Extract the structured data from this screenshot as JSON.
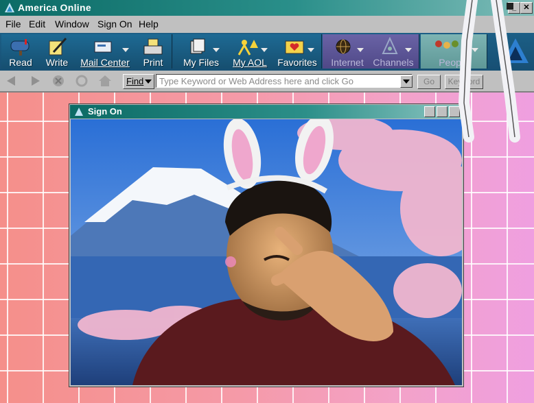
{
  "window": {
    "title": "America  Online",
    "minimize_glyph": "_",
    "close_glyph": "✕"
  },
  "menu": {
    "items": [
      "File",
      "Edit",
      "Window",
      "Sign On",
      "Help"
    ]
  },
  "toolbar": {
    "buttons": [
      {
        "label": "Read",
        "icon": "mailbox-icon"
      },
      {
        "label": "Write",
        "icon": "pencil-paper-icon"
      },
      {
        "label": "Mail Center",
        "icon": "mail-center-icon"
      },
      {
        "label": "Print",
        "icon": "printer-icon"
      },
      {
        "label": "My Files",
        "icon": "files-icon"
      },
      {
        "label": "My AOL",
        "icon": "my-aol-icon"
      },
      {
        "label": "Favorites",
        "icon": "heart-folder-icon"
      },
      {
        "label": "Internet",
        "icon": "globe-icon"
      },
      {
        "label": "Channels",
        "icon": "channels-icon"
      },
      {
        "label": "People",
        "icon": "people-icon"
      }
    ]
  },
  "navbar": {
    "find_label": "Find",
    "keyword_placeholder": "Type Keyword or Web Address here and click Go",
    "go_label": "Go",
    "keyword_label": "Keyword"
  },
  "signon": {
    "title": "Sign On"
  },
  "colors": {
    "title_bar": "#0c6b66",
    "toolbar": "#1c5f86",
    "toolbar_purple": "#5b5596",
    "desktop_left": "#f58f8a",
    "desktop_right": "#ef9fe0"
  }
}
